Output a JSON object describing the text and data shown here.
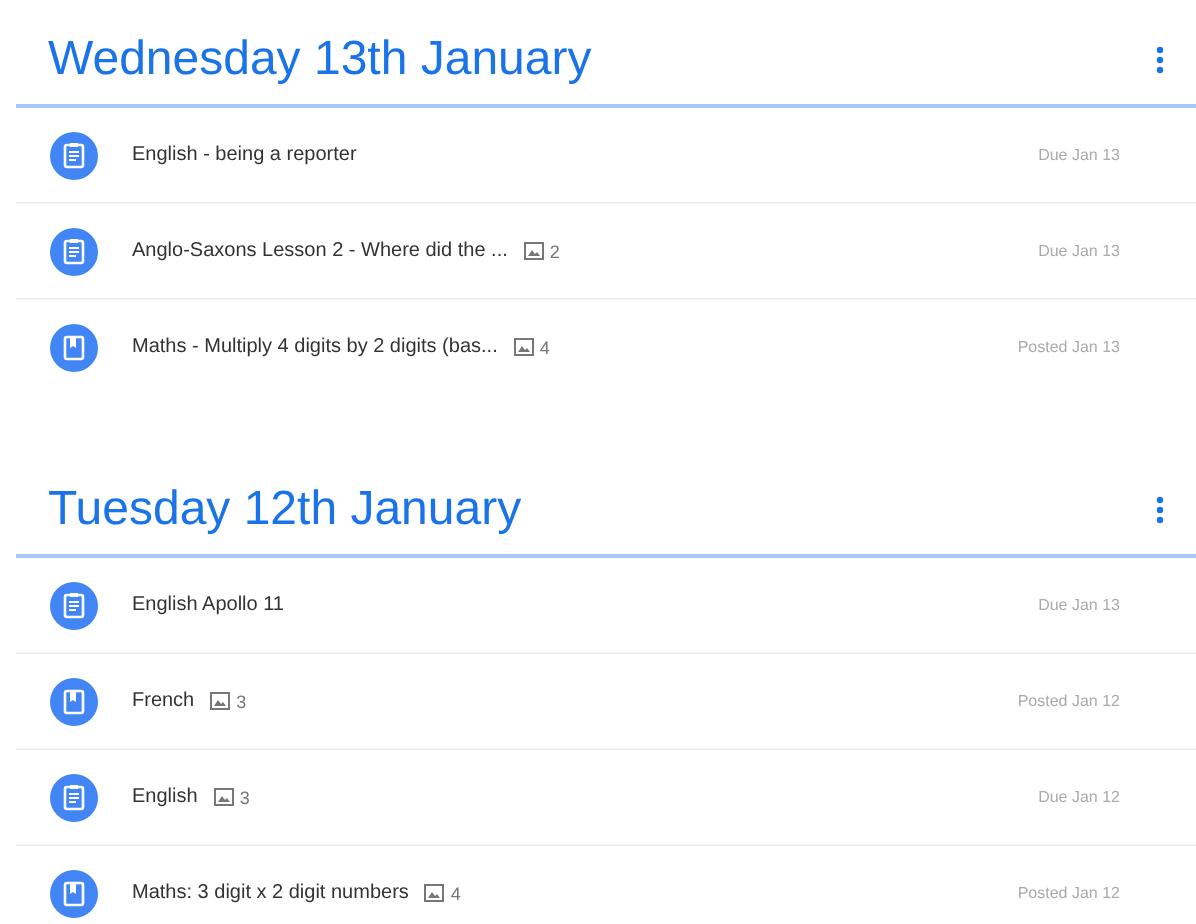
{
  "sections": [
    {
      "title": "Wednesday 13th January",
      "items": [
        {
          "kind": "assignment",
          "title": "English - being a reporter",
          "date": "Due Jan 13"
        },
        {
          "kind": "assignment",
          "title": "Anglo-Saxons Lesson 2 - Where did the ...",
          "attachments": "2",
          "date": "Due Jan 13"
        },
        {
          "kind": "material",
          "title": "Maths - Multiply 4 digits by 2 digits (bas...",
          "attachments": "4",
          "date": "Posted Jan 13"
        }
      ]
    },
    {
      "title": "Tuesday 12th January",
      "items": [
        {
          "kind": "assignment",
          "title": "English Apollo 11",
          "date": "Due Jan 13"
        },
        {
          "kind": "material",
          "title": "French",
          "attachments": "3",
          "date": "Posted Jan 12"
        },
        {
          "kind": "assignment",
          "title": "English",
          "attachments": "3",
          "date": "Due Jan 12"
        },
        {
          "kind": "material",
          "title": "Maths: 3 digit x 2 digit numbers",
          "attachments": "4",
          "date": "Posted Jan 12"
        }
      ]
    }
  ]
}
